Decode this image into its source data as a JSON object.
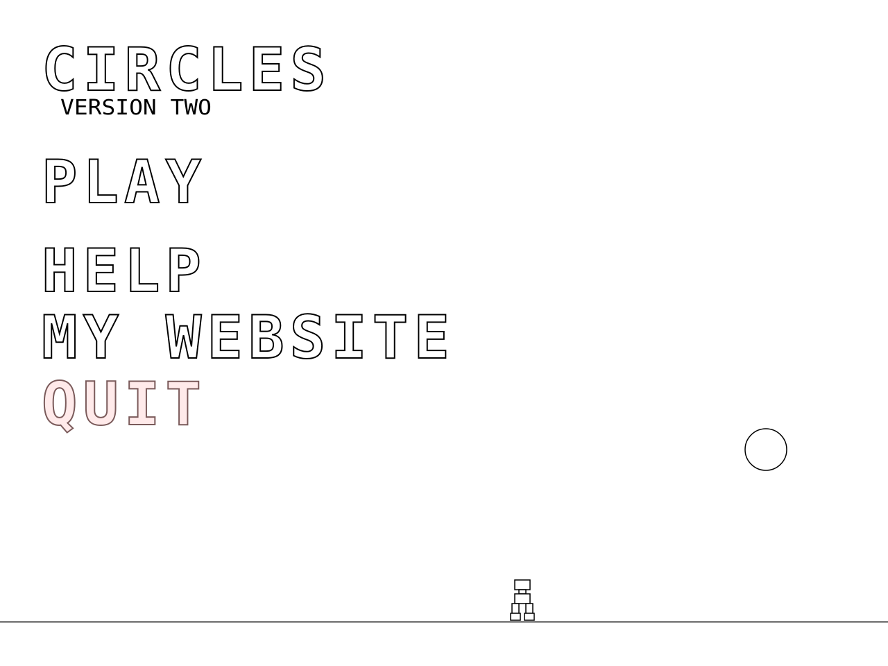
{
  "title": "CIRCLES",
  "subtitle": "VERSION TWO",
  "menu": {
    "play": "PLAY",
    "help": "HELP",
    "website": "MY WEBSITE",
    "quit": "QUIT"
  },
  "selected_item": "quit",
  "colors": {
    "background": "#ffffff",
    "outline": "#000000",
    "selected_fill": "#ffeaea"
  },
  "icons": {
    "ball": "circle-icon",
    "player": "player-character-icon"
  }
}
